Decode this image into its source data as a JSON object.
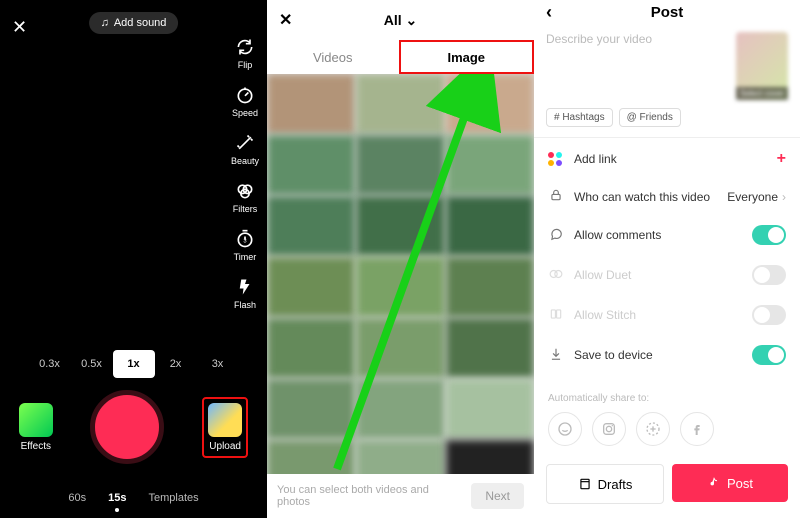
{
  "camera": {
    "add_sound": "Add sound",
    "tools": {
      "flip": "Flip",
      "speed": "Speed",
      "beauty": "Beauty",
      "filters": "Filters",
      "timer": "Timer",
      "flash": "Flash"
    },
    "zoom": {
      "z03": "0.3x",
      "z05": "0.5x",
      "z1": "1x",
      "z2": "2x",
      "z3": "3x"
    },
    "effects": "Effects",
    "upload": "Upload",
    "modes": {
      "m60": "60s",
      "m15": "15s",
      "templates": "Templates"
    }
  },
  "gallery": {
    "title": "All",
    "tab_videos": "Videos",
    "tab_image": "Image",
    "footer_hint": "You can select both videos and photos",
    "next": "Next"
  },
  "post": {
    "title": "Post",
    "describe_placeholder": "Describe your video",
    "select_cover": "Select cover",
    "chip_hashtags": "# Hashtags",
    "chip_friends": "@ Friends",
    "rows": {
      "add_link": "Add link",
      "who": "Who can watch this video",
      "who_value": "Everyone",
      "comments": "Allow comments",
      "duet": "Allow Duet",
      "stitch": "Allow Stitch",
      "save": "Save to device"
    },
    "auto_share": "Automatically share to:",
    "drafts": "Drafts",
    "post": "Post"
  }
}
